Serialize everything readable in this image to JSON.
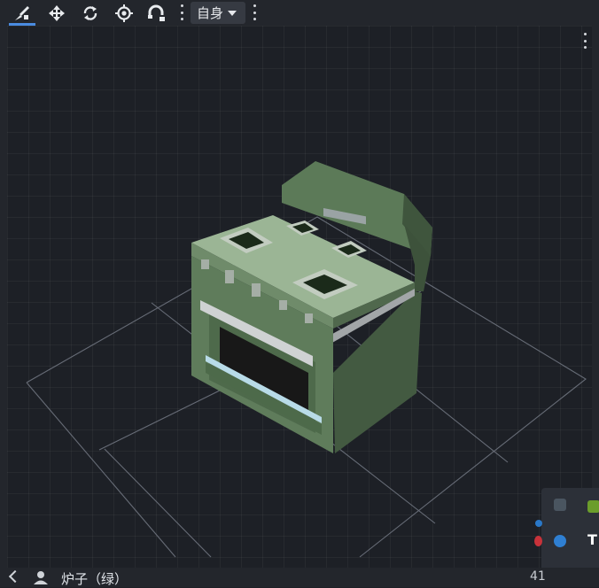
{
  "toolbar": {
    "tools": [
      {
        "icon": "select-brush-icon",
        "active": true
      },
      {
        "icon": "move-icon",
        "active": false
      },
      {
        "icon": "rotate-icon",
        "active": false
      },
      {
        "icon": "target-icon",
        "active": false
      },
      {
        "icon": "snap-magnet-icon",
        "active": false
      }
    ],
    "mode_label": "自身"
  },
  "status": {
    "object_label": "炉子（绿）",
    "count_text": "41"
  },
  "tray": {
    "label": "T"
  },
  "colors": {
    "accent": "#4a8be0",
    "stove_top": "#9bb595",
    "stove_side": "#435a41",
    "stove_front": "#5f7c5b",
    "oven_window": "#181818"
  }
}
